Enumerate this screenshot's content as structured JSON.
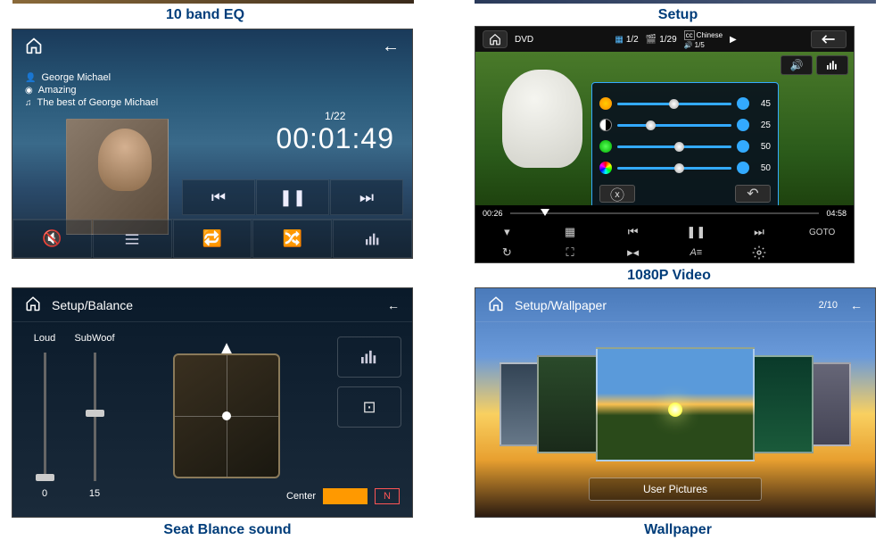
{
  "captions": {
    "eq": "10 band EQ",
    "setup": "Setup",
    "video": "1080P Video",
    "seat": "Seat Blance sound",
    "wallpaper": "Wallpaper"
  },
  "music": {
    "artist": "George Michael",
    "album": "Amazing",
    "playlist": "The best of George Michael",
    "track": "1/22",
    "time": "00:01:49"
  },
  "video": {
    "source": "DVD",
    "chapter": "1/2",
    "title_idx": "1/29",
    "subtitle": "Chinese",
    "audio_track": "1/5",
    "pos": "00:26",
    "dur": "04:58",
    "goto": "GOTO",
    "adj": {
      "brightness": "45",
      "contrast": "25",
      "color": "50",
      "tint": "50"
    }
  },
  "seat": {
    "header": "Setup/Balance",
    "loud_label": "Loud",
    "sub_label": "SubWoof",
    "loud_val": "0",
    "sub_val": "15",
    "center": "Center",
    "n": "N"
  },
  "wall": {
    "header": "Setup/Wallpaper",
    "count": "2/10",
    "user_btn": "User Pictures"
  }
}
